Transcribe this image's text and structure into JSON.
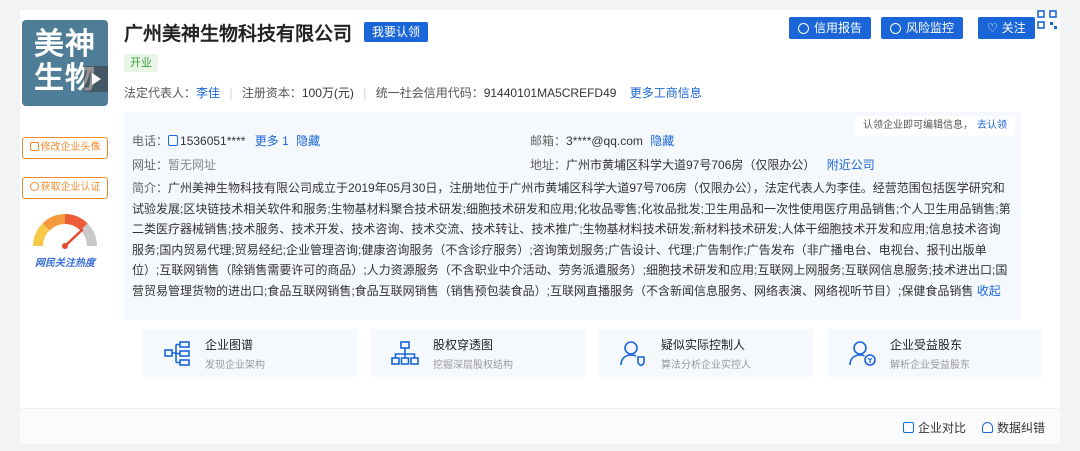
{
  "company": {
    "logo_text": "美神\n生物",
    "name": "广州美神生物科技有限公司",
    "claim_label": "我要认领",
    "status": "开业"
  },
  "info": {
    "legal_rep_label": "法定代表人：",
    "legal_rep": "李佳",
    "capital_label": "注册资本：",
    "capital": "100万(元)",
    "credit_label": "统一社会信用代码：",
    "credit_code": "91440101MA5CREFD49",
    "more_link": "更多工商信息"
  },
  "actions": {
    "credit_report": "信用报告",
    "risk_monitor": "风险监控",
    "follow": "关注"
  },
  "sidebar": {
    "edit_logo": "修改企业头像",
    "get_cert": "获取企业认证",
    "gauge_label": "网民关注热度"
  },
  "detail": {
    "phone_label": "电话：",
    "phone": "1536051****",
    "phone_more": "更多 1",
    "phone_hide": "隐藏",
    "email_label": "邮箱：",
    "email": "3****@qq.com",
    "email_hide": "隐藏",
    "tip_text": "认领企业即可编辑信息，",
    "tip_link": "去认领",
    "website_label": "网址：",
    "website": "暂无网址",
    "address_label": "地址：",
    "address": "广州市黄埔区科学大道97号706房（仅限办公）",
    "nearby_link": "附近公司",
    "intro_label": "简介：",
    "intro_text": "广州美神生物科技有限公司成立于2019年05月30日，注册地位于广州市黄埔区科学大道97号706房（仅限办公），法定代表人为李佳。经营范围包括医学研究和试验发展;区块链技术相关软件和服务;生物基材料聚合技术研发;细胞技术研发和应用;化妆品零售;化妆品批发;卫生用品和一次性使用医疗用品销售;个人卫生用品销售;第二类医疗器械销售;技术服务、技术开发、技术咨询、技术交流、技术转让、技术推广;生物基材料技术研发;新材料技术研发;人体干细胞技术开发和应用;信息技术咨询服务;国内贸易代理;贸易经纪;企业管理咨询;健康咨询服务（不含诊疗服务）;咨询策划服务;广告设计、代理;广告制作;广告发布（非广播电台、电视台、报刊出版单位）;互联网销售（除销售需要许可的商品）;人力资源服务（不含职业中介活动、劳务派遣服务）;细胞技术研发和应用;互联网上网服务;互联网信息服务;技术进出口;国营贸易管理货物的进出口;食品互联网销售;食品互联网销售（销售预包装食品）;互联网直播服务（不含新闻信息服务、网络表演、网络视听节目）;保健食品销售",
    "collapse_link": "收起"
  },
  "features": [
    {
      "title": "企业图谱",
      "sub": "发现企业架构",
      "icon": "org-chart-icon"
    },
    {
      "title": "股权穿透图",
      "sub": "挖掘深层股权结构",
      "icon": "equity-tree-icon"
    },
    {
      "title": "疑似实际控制人",
      "sub": "算法分析企业实控人",
      "icon": "controller-icon"
    },
    {
      "title": "企业受益股东",
      "sub": "解析企业受益股东",
      "icon": "beneficiary-icon"
    }
  ],
  "footer": {
    "compare": "企业对比",
    "correction": "数据纠错"
  },
  "colors": {
    "primary": "#1a66d8",
    "accent": "#f28b30",
    "status_green": "#3aa33a",
    "logo_bg": "#4f7d97"
  }
}
